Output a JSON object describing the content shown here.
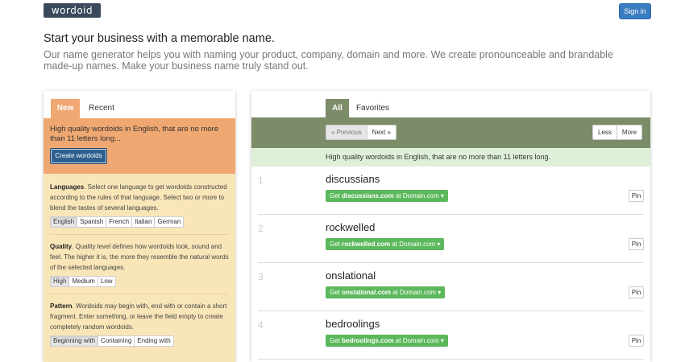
{
  "header": {
    "logo_text": "wordoid",
    "signin_label": "Sign in"
  },
  "hero": {
    "title": "Start your business with a memorable name.",
    "description": "Our name generator helps you with naming your product, company, domain and more. We create pronounceable and brandable made-up names. Make your business name truly stand out."
  },
  "left": {
    "tabs": [
      "New",
      "Recent"
    ],
    "summary": "High quality wordoids in English, that are no more than 11 letters long...",
    "create_label": "Create wordoids",
    "languages": {
      "heading": "Languages",
      "text": ". Select one language to get wordoids constructed according to the rules of that language. Select two or more to blend the tastes of several languages.",
      "options": [
        "English",
        "Spanish",
        "French",
        "Italian",
        "German"
      ],
      "selected": "English"
    },
    "quality": {
      "heading": "Quality",
      "text": ". Quality level defines how wordoids look, sound and feel. The higher it is, the more they resemble the natural words of the selected languages.",
      "options": [
        "High",
        "Medium",
        "Low"
      ],
      "selected": "High"
    },
    "pattern": {
      "heading": "Pattern",
      "text": ". Wordoids may begin with, end with or contain a short fragment. Enter something, or leave the field empty to create completely random wordoids.",
      "options": [
        "Beginning with",
        "Containing",
        "Ending with"
      ],
      "selected": "Beginning with"
    }
  },
  "right": {
    "tabs": [
      "All",
      "Favorites"
    ],
    "prev_label": "« Previous",
    "next_label": "Next »",
    "less_label": "Less",
    "more_label": "More",
    "info": "High quality wordoids in English, that are no more than 11 letters long.",
    "words": [
      {
        "num": "1",
        "name": "discussians",
        "prefix": "Get ",
        "domain": "discussians.com",
        "suffix": " at Domain.com",
        "pin": "Pin"
      },
      {
        "num": "2",
        "name": "rockwelled",
        "prefix": "Get ",
        "domain": "rockwelled.com",
        "suffix": " at Domain.com",
        "pin": "Pin"
      },
      {
        "num": "3",
        "name": "onslational",
        "prefix": "Get ",
        "domain": "onslational.com",
        "suffix": " at Domain.com",
        "pin": "Pin"
      },
      {
        "num": "4",
        "name": "bedroolings",
        "prefix": "Get ",
        "domain": "bedroolings.com",
        "suffix": " at Domain.com",
        "pin": "Pin"
      }
    ],
    "caret": "▾"
  },
  "colors": {
    "orange": "#f0a872",
    "cream": "#f9e6b8",
    "olive": "#7c8b68",
    "green": "#5cb85c",
    "blue": "#3a7cc0"
  }
}
